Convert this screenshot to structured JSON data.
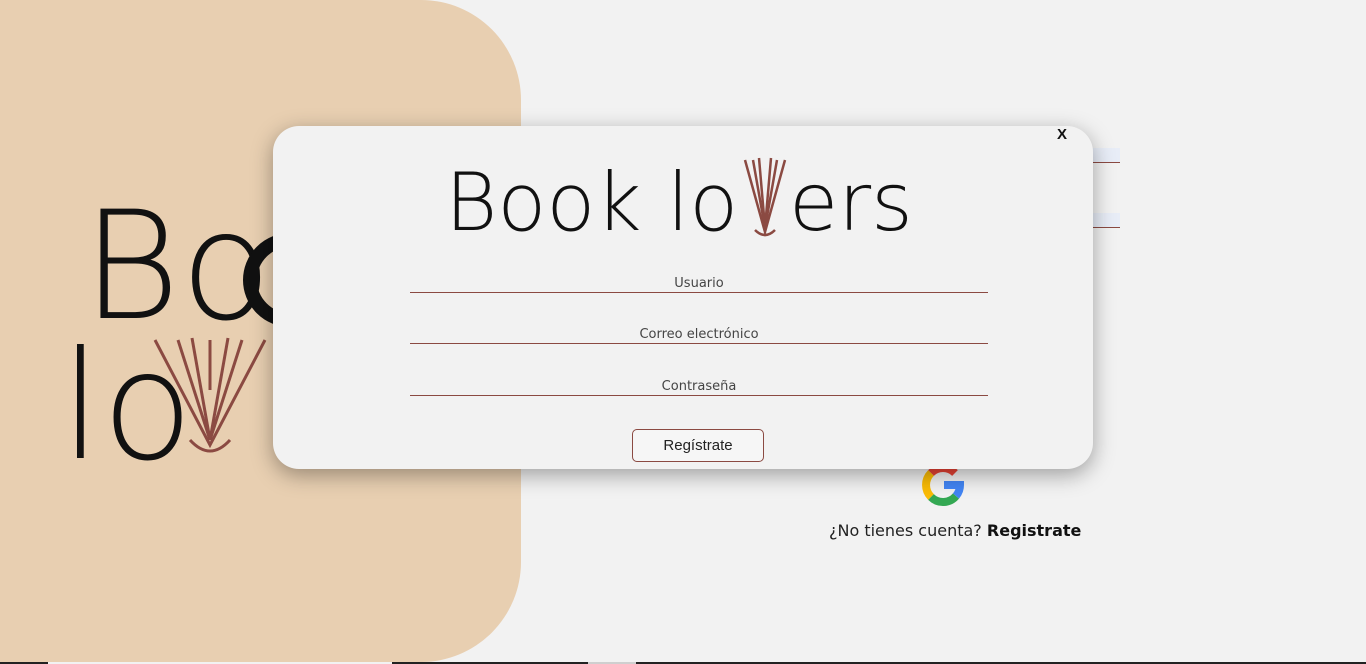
{
  "background": {
    "logo_word1": "Bo",
    "logo_word2": "lo",
    "no_account_text": "¿No tienes cuenta?",
    "signup_link": "Registrate",
    "colors": {
      "panel": "#e8cfb1",
      "page": "#f2f2f2"
    }
  },
  "modal": {
    "close_label": "X",
    "logo_text_1": "Book lo",
    "logo_text_2": "ers",
    "fields": {
      "username_placeholder": "Usuario",
      "email_placeholder": "Correo electrónico",
      "password_placeholder": "Contraseña"
    },
    "submit_label": "Regístrate",
    "colors": {
      "accent": "#8b4a42",
      "modal_bg": "#f2f2f2"
    }
  }
}
